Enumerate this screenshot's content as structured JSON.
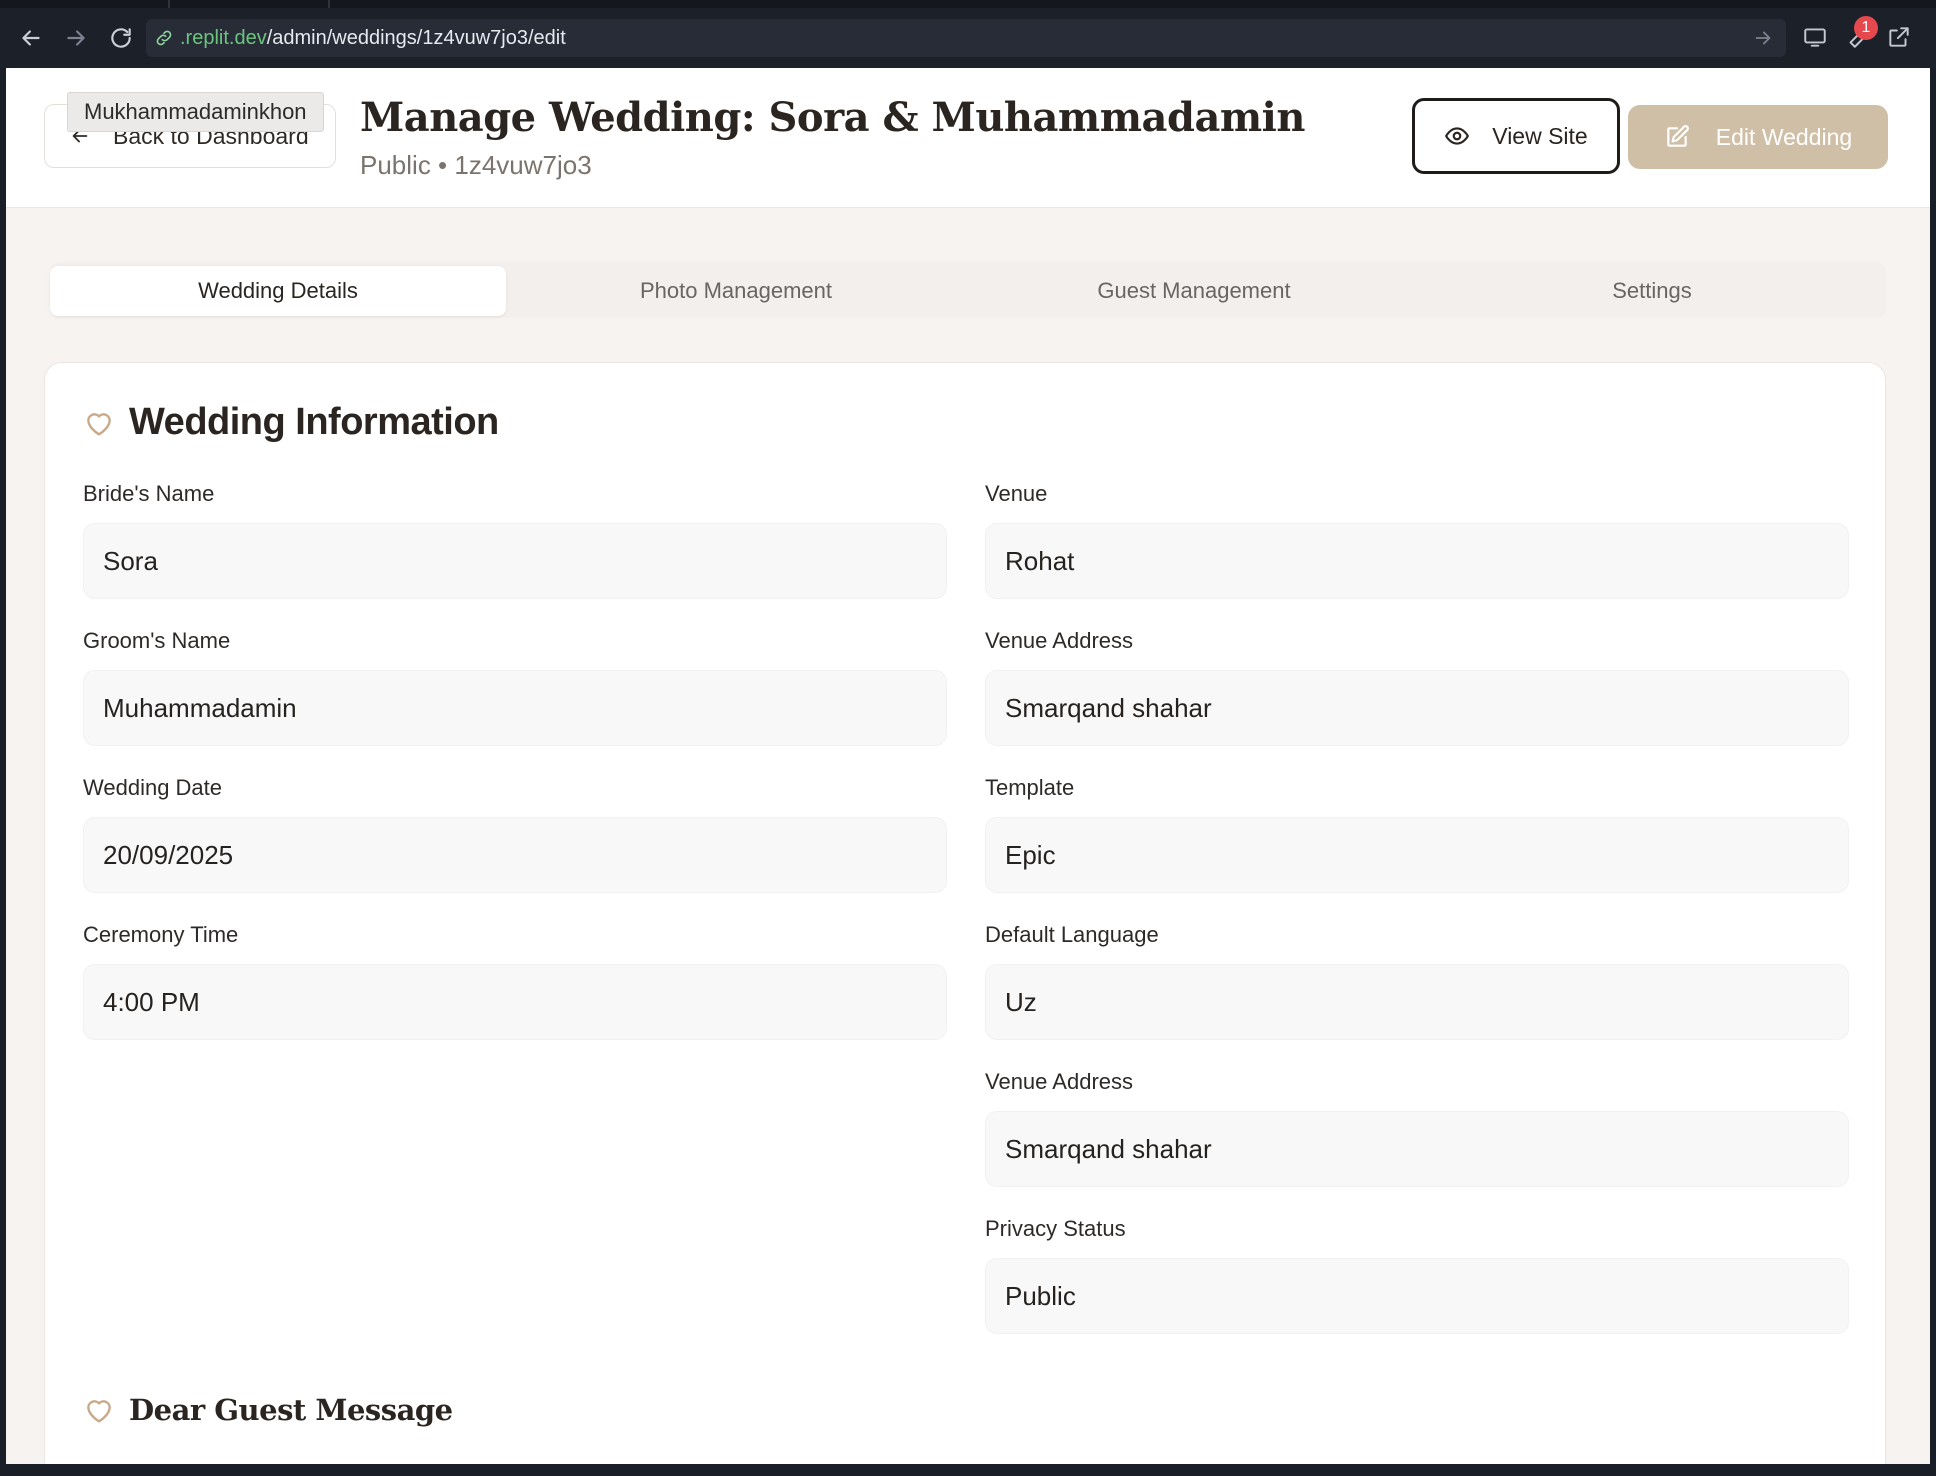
{
  "browser": {
    "url_host": ".replit.dev",
    "url_path": "/admin/weddings/1z4vuw7jo3/edit",
    "notification_count": "1"
  },
  "header": {
    "tooltip": "Mukhammadaminkhon",
    "back_label": "Back to Dashboard",
    "title": "Manage Wedding: Sora & Muhammadamin",
    "subtitle": "Public • 1z4vuw7jo3",
    "view_site_label": "View Site",
    "edit_label": "Edit Wedding"
  },
  "tabs": [
    {
      "label": "Wedding Details",
      "active": true
    },
    {
      "label": "Photo Management",
      "active": false
    },
    {
      "label": "Guest Management",
      "active": false
    },
    {
      "label": "Settings",
      "active": false
    }
  ],
  "wedding_info": {
    "title": "Wedding Information",
    "left_fields": [
      {
        "label": "Bride's Name",
        "value": "Sora"
      },
      {
        "label": "Groom's Name",
        "value": "Muhammadamin"
      },
      {
        "label": "Wedding Date",
        "value": "20/09/2025"
      },
      {
        "label": "Ceremony Time",
        "value": "4:00 PM"
      }
    ],
    "right_fields": [
      {
        "label": "Venue",
        "value": "Rohat"
      },
      {
        "label": "Venue Address",
        "value": "Smarqand shahar"
      },
      {
        "label": "Template",
        "value": "Epic"
      },
      {
        "label": "Default Language",
        "value": "Uz"
      },
      {
        "label": "Venue Address",
        "value": "Smarqand shahar"
      },
      {
        "label": "Privacy Status",
        "value": "Public"
      }
    ]
  },
  "dear_guest": {
    "title": "Dear Guest Message"
  },
  "colors": {
    "accent": "#cfbfa7",
    "heart": "#c9a98a",
    "url_host": "#6cc57f"
  }
}
